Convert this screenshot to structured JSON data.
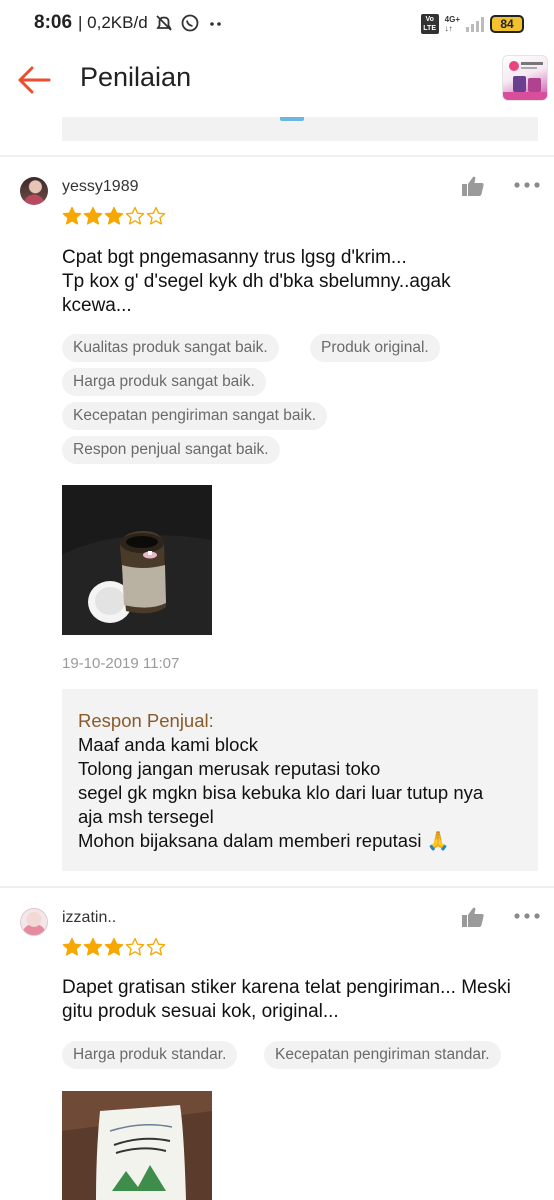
{
  "status_bar": {
    "time": "8:06",
    "speed": "| 0,2KB/d",
    "network": "4G+",
    "volte": "Vo LTE",
    "battery": "84"
  },
  "header": {
    "title": "Penilaian"
  },
  "reviews": [
    {
      "username": "yessy1989",
      "rating": 3,
      "max_rating": 5,
      "text_lines": [
        "Cpat bgt pngemasanny trus lgsg d'krim...",
        "Tp kox g' d'segel kyk dh d'bka sbelumny..agak",
        "kcewa..."
      ],
      "tags": [
        "Kualitas produk sangat baik.",
        "Produk original.",
        "Harga produk sangat baik.",
        "Kecepatan pengiriman sangat baik.",
        "Respon penjual sangat baik."
      ],
      "timestamp": "19-10-2019 11:07",
      "seller_response": {
        "title": "Respon Penjual:",
        "lines": [
          "Maaf anda kami block",
          "Tolong jangan merusak reputasi toko",
          "segel gk mgkn bisa kebuka klo dari luar tutup nya",
          "aja msh tersegel",
          "Mohon bijaksana dalam memberi reputasi 🙏"
        ]
      }
    },
    {
      "username": "izzatin..",
      "rating": 3,
      "max_rating": 5,
      "text_lines": [
        "Dapet gratisan stiker karena telat pengiriman... Meski",
        "gitu produk sesuai kok, original..."
      ],
      "tags": [
        "Harga produk standar.",
        "Kecepatan pengiriman standar."
      ]
    }
  ],
  "colors": {
    "accent": "#ee4d2d",
    "star": "#f6a700",
    "seller_title": "#8a5a2b"
  }
}
